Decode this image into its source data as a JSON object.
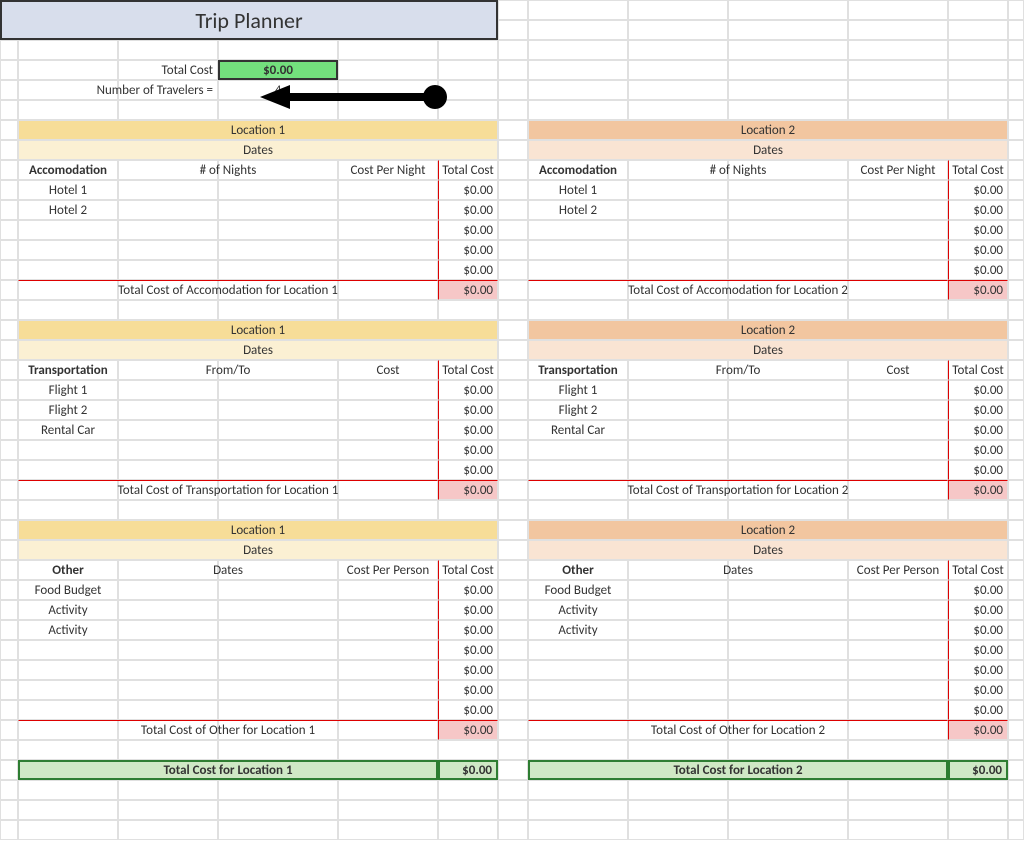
{
  "title": "Trip Planner",
  "summary": {
    "total_cost_label": "Total Cost",
    "total_cost_value": "$0.00",
    "travelers_label": "Number of Travelers  =",
    "travelers_value": "4"
  },
  "loc1": {
    "name": "Location 1",
    "dates": "Dates",
    "accom": {
      "col1": "Accomodation",
      "col2": "# of Nights",
      "col3": "Cost Per Night",
      "col4": "Total Cost",
      "rows": [
        "Hotel 1",
        "Hotel 2",
        "",
        "",
        ""
      ],
      "vals": [
        "$0.00",
        "$0.00",
        "$0.00",
        "$0.00",
        "$0.00"
      ],
      "sum_label": "Total Cost of Accomodation for Location 1",
      "sum": "$0.00"
    },
    "trans": {
      "col1": "Transportation",
      "col2": "From/To",
      "col3": "Cost",
      "col4": "Total Cost",
      "rows": [
        "Flight 1",
        "Flight 2",
        "Rental Car",
        "",
        ""
      ],
      "vals": [
        "$0.00",
        "$0.00",
        "$0.00",
        "$0.00",
        "$0.00"
      ],
      "sum_label": "Total Cost of Transportation for Location 1",
      "sum": "$0.00"
    },
    "other": {
      "col1": "Other",
      "col2": "Dates",
      "col3": "Cost Per Person",
      "col4": "Total Cost",
      "rows": [
        "Food Budget",
        "Activity",
        "Activity",
        "",
        "",
        "",
        ""
      ],
      "vals": [
        "$0.00",
        "$0.00",
        "$0.00",
        "$0.00",
        "$0.00",
        "$0.00",
        "$0.00"
      ],
      "sum_label": "Total Cost of Other for Location 1",
      "sum": "$0.00"
    },
    "total_label": "Total Cost for Location 1",
    "total": "$0.00"
  },
  "loc2": {
    "name": "Location 2",
    "dates": "Dates",
    "accom": {
      "col1": "Accomodation",
      "col2": "# of Nights",
      "col3": "Cost Per Night",
      "col4": "Total Cost",
      "rows": [
        "Hotel 1",
        "Hotel 2",
        "",
        "",
        ""
      ],
      "vals": [
        "$0.00",
        "$0.00",
        "$0.00",
        "$0.00",
        "$0.00"
      ],
      "sum_label": "Total Cost of Accomodation for Location 2",
      "sum": "$0.00"
    },
    "trans": {
      "col1": "Transportation",
      "col2": "From/To",
      "col3": "Cost",
      "col4": "Total Cost",
      "rows": [
        "Flight 1",
        "Flight 2",
        "Rental Car",
        "",
        ""
      ],
      "vals": [
        "$0.00",
        "$0.00",
        "$0.00",
        "$0.00",
        "$0.00"
      ],
      "sum_label": "Total Cost of Transportation for Location 2",
      "sum": "$0.00"
    },
    "other": {
      "col1": "Other",
      "col2": "Dates",
      "col3": "Cost Per Person",
      "col4": "Total Cost",
      "rows": [
        "Food Budget",
        "Activity",
        "Activity",
        "",
        "",
        "",
        ""
      ],
      "vals": [
        "$0.00",
        "$0.00",
        "$0.00",
        "$0.00",
        "$0.00",
        "$0.00",
        "$0.00"
      ],
      "sum_label": "Total Cost of Other for Location 2",
      "sum": "$0.00"
    },
    "total_label": "Total Cost for Location 2",
    "total": "$0.00"
  }
}
